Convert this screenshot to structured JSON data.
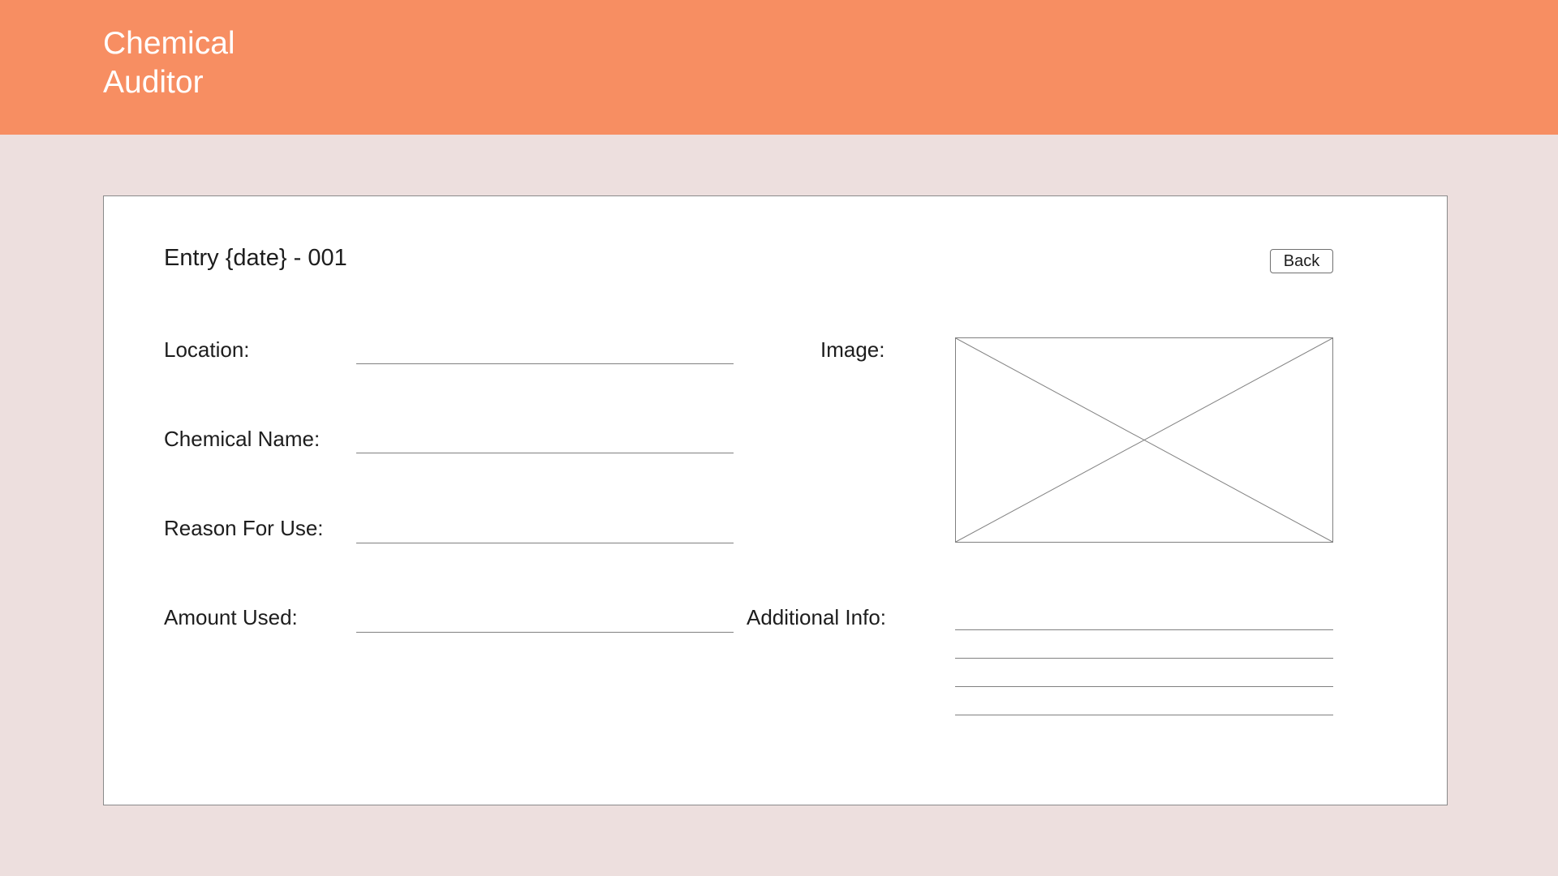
{
  "app": {
    "title_line1": "Chemical",
    "title_line2": "Auditor"
  },
  "entry": {
    "title": "Entry {date} - 001",
    "back_label": "Back"
  },
  "form": {
    "location_label": "Location:",
    "chemical_name_label": "Chemical Name:",
    "reason_label": "Reason For Use:",
    "amount_label": "Amount Used:",
    "image_label": "Image:",
    "additional_info_label": "Additional Info:"
  },
  "colors": {
    "header": "#f78e62",
    "background": "#eddfde",
    "panel": "#ffffff"
  }
}
